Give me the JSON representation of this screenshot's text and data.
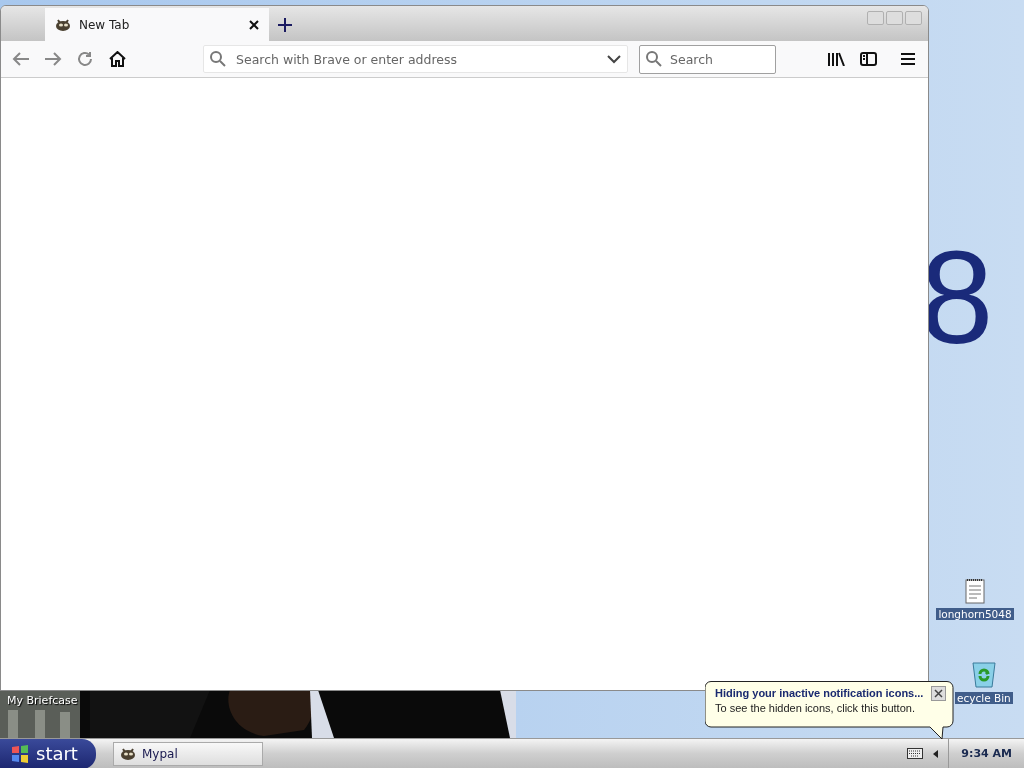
{
  "browser": {
    "tabs": [
      {
        "label": "New Tab",
        "selected": true
      }
    ],
    "address": {
      "placeholder": "Search with Brave or enter address"
    },
    "search": {
      "placeholder": "Search"
    }
  },
  "desktop": {
    "wallpaper_text": "8",
    "briefcase": "My Briefcase",
    "icons": [
      {
        "label": "longhorn5048",
        "kind": "document"
      },
      {
        "label": "ecycle Bin",
        "kind": "recycle"
      }
    ]
  },
  "balloon": {
    "title": "Hiding your inactive notification icons...",
    "text": "To see the hidden icons, click this button."
  },
  "taskbar": {
    "start": "start",
    "tasks": [
      {
        "label": "Mypal",
        "selected": false
      }
    ],
    "clock": "9:34 AM"
  }
}
